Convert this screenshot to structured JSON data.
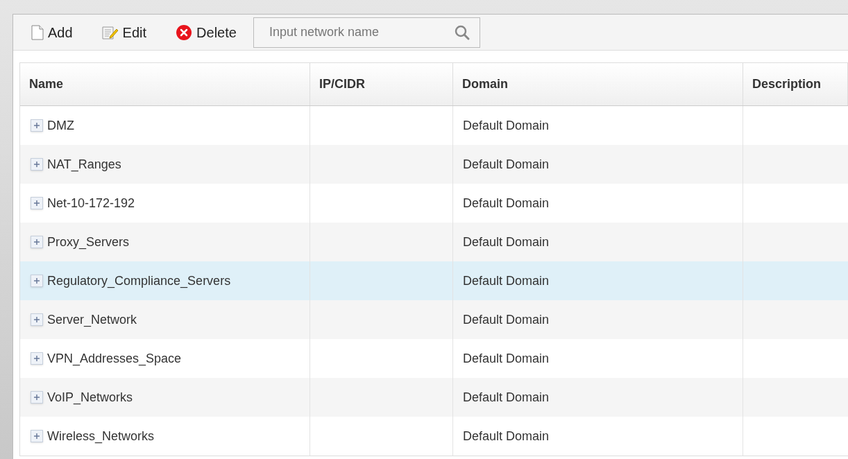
{
  "toolbar": {
    "buttons": [
      {
        "kind": "add",
        "label": "Add"
      },
      {
        "kind": "edit",
        "label": "Edit"
      },
      {
        "kind": "delete",
        "label": "Delete"
      }
    ],
    "search": {
      "placeholder": "Input network name"
    }
  },
  "table": {
    "columns": [
      "Name",
      "IP/CIDR",
      "Domain",
      "Description"
    ],
    "rows": [
      {
        "name": "DMZ",
        "domain": "Default Domain",
        "expanded": false,
        "selected": false
      },
      {
        "name": "NAT_Ranges",
        "domain": "Default Domain",
        "expanded": false,
        "selected": false
      },
      {
        "name": "Net-10-172-192",
        "domain": "Default Domain",
        "expanded": false,
        "selected": false
      },
      {
        "name": "Proxy_Servers",
        "domain": "Default Domain",
        "expanded": false,
        "selected": false
      },
      {
        "name": "Regulatory_Compliance_Servers",
        "domain": "Default Domain",
        "expanded": false,
        "selected": true
      },
      {
        "name": "Server_Network",
        "domain": "Default Domain",
        "expanded": false,
        "selected": false
      },
      {
        "name": "VPN_Addresses_Space",
        "domain": "Default Domain",
        "expanded": false,
        "selected": false
      },
      {
        "name": "VoIP_Networks",
        "domain": "Default Domain",
        "expanded": false,
        "selected": false
      },
      {
        "name": "Wireless_Networks",
        "domain": "Default Domain",
        "expanded": false,
        "selected": false
      }
    ]
  }
}
